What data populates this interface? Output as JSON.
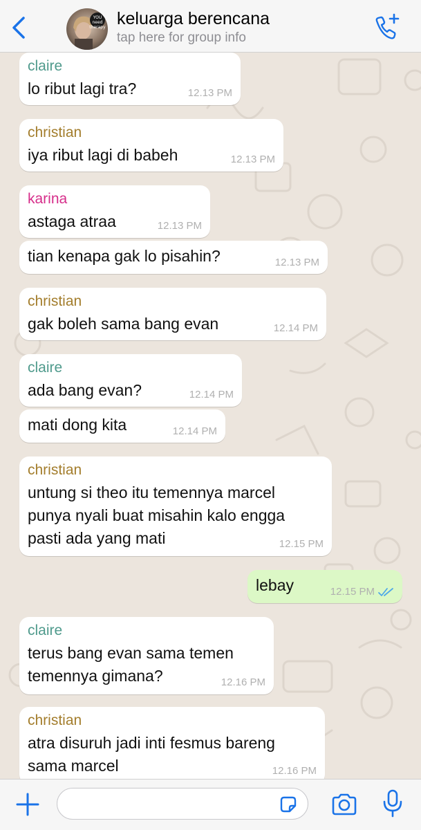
{
  "header": {
    "title": "keluarga berencana",
    "subtitle": "tap here for group info",
    "avatar_text": "YOU need therapy"
  },
  "colors": {
    "accent": "#1a73e8",
    "outgoing_bubble": "#dcf8c6",
    "incoming_bubble": "#ffffff",
    "sender_claire": "#4f9a8c",
    "sender_christian": "#a37d2c",
    "sender_karina": "#d62d8a",
    "read_ticks": "#4fa8e8"
  },
  "messages": [
    {
      "sender": "claire",
      "text": "lo ribut lagi tra?",
      "time": "12.13 PM"
    },
    {
      "sender": "christian",
      "text": "iya ribut lagi di babeh",
      "time": "12.13 PM"
    },
    {
      "sender": "karina",
      "text": "astaga atraa",
      "time": "12.13 PM"
    },
    {
      "sender": "",
      "text": "tian kenapa gak lo pisahin?",
      "time": "12.13 PM"
    },
    {
      "sender": "christian",
      "text": "gak boleh sama bang evan",
      "time": "12.14 PM"
    },
    {
      "sender": "claire",
      "text": "ada bang evan?",
      "time": "12.14 PM"
    },
    {
      "sender": "",
      "text": "mati dong kita",
      "time": "12.14 PM"
    },
    {
      "sender": "christian",
      "lines": [
        "untung si theo itu temennya marcel",
        "punya nyali buat misahin kalo engga",
        "pasti ada yang mati"
      ],
      "time": "12.15 PM"
    },
    {
      "sender": "",
      "text": "lebay",
      "time": "12.15 PM",
      "outgoing": true,
      "status_icon": "double-check-read-icon"
    },
    {
      "sender": "claire",
      "lines": [
        "terus bang evan sama temen",
        "temennya gimana?"
      ],
      "time": "12.16 PM"
    },
    {
      "sender": "christian",
      "lines": [
        "atra disuruh jadi inti fesmus bareng",
        "sama marcel"
      ],
      "time": "12.16 PM"
    }
  ],
  "input_bar": {
    "placeholder": "",
    "icons": [
      "plus-icon",
      "sticker-icon",
      "camera-icon",
      "microphone-icon"
    ]
  }
}
